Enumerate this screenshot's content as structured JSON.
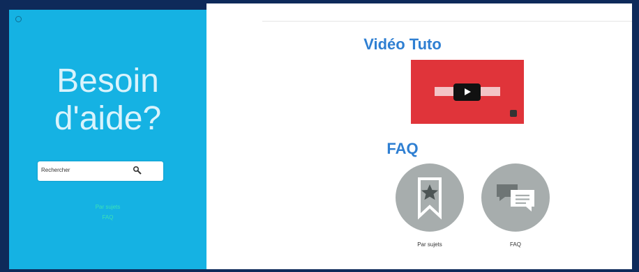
{
  "sidebar": {
    "title_line1": "Besoin",
    "title_line2": "d'aide?",
    "search": {
      "placeholder": "Rechercher"
    },
    "link1": "Par sujets",
    "link2": "FAQ"
  },
  "main": {
    "video_section_title": "Vidéo Tuto",
    "faq_section_title": "FAQ",
    "tiles": [
      {
        "label": "Par sujets",
        "icon": "bookmark-star-icon"
      },
      {
        "label": "FAQ",
        "icon": "chat-bubbles-icon"
      }
    ]
  },
  "colors": {
    "sidebar": "#15b2e3",
    "accent": "#2f7fd2",
    "video": "#e0343a",
    "tile": "#a7adad",
    "frame": "#0e2a5a"
  }
}
